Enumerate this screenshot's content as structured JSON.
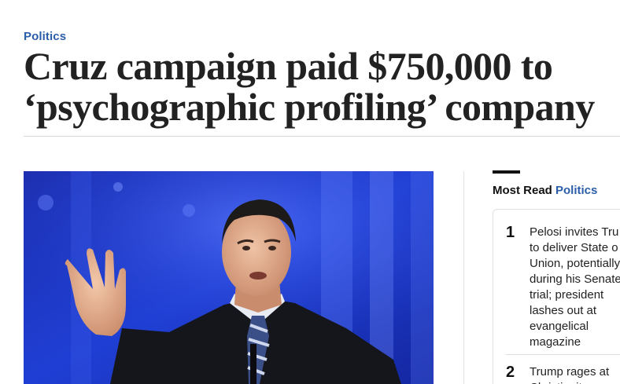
{
  "article": {
    "kicker": "Politics",
    "headline_line1": "Cruz campaign paid $750,000 to",
    "headline_line2": "‘psychographic profiling’ company"
  },
  "lead_image": {
    "subject": "photo of a man in a dark suit with a blue striped tie gesturing at a podium, blue stage background"
  },
  "most_read": {
    "label": "Most Read",
    "section": "Politics",
    "items": [
      {
        "rank": "1",
        "text": "Pelosi invites Tru\nto deliver State o\nUnion, potentially\nduring his Senate\ntrial; president\nlashes out at\nevangelical\nmagazine"
      },
      {
        "rank": "2",
        "text": "Trump rages at\nChristianity..."
      }
    ]
  },
  "colors": {
    "section_blue": "#2a5ea8",
    "headline": "#222222",
    "rule": "#d6d6d6"
  }
}
